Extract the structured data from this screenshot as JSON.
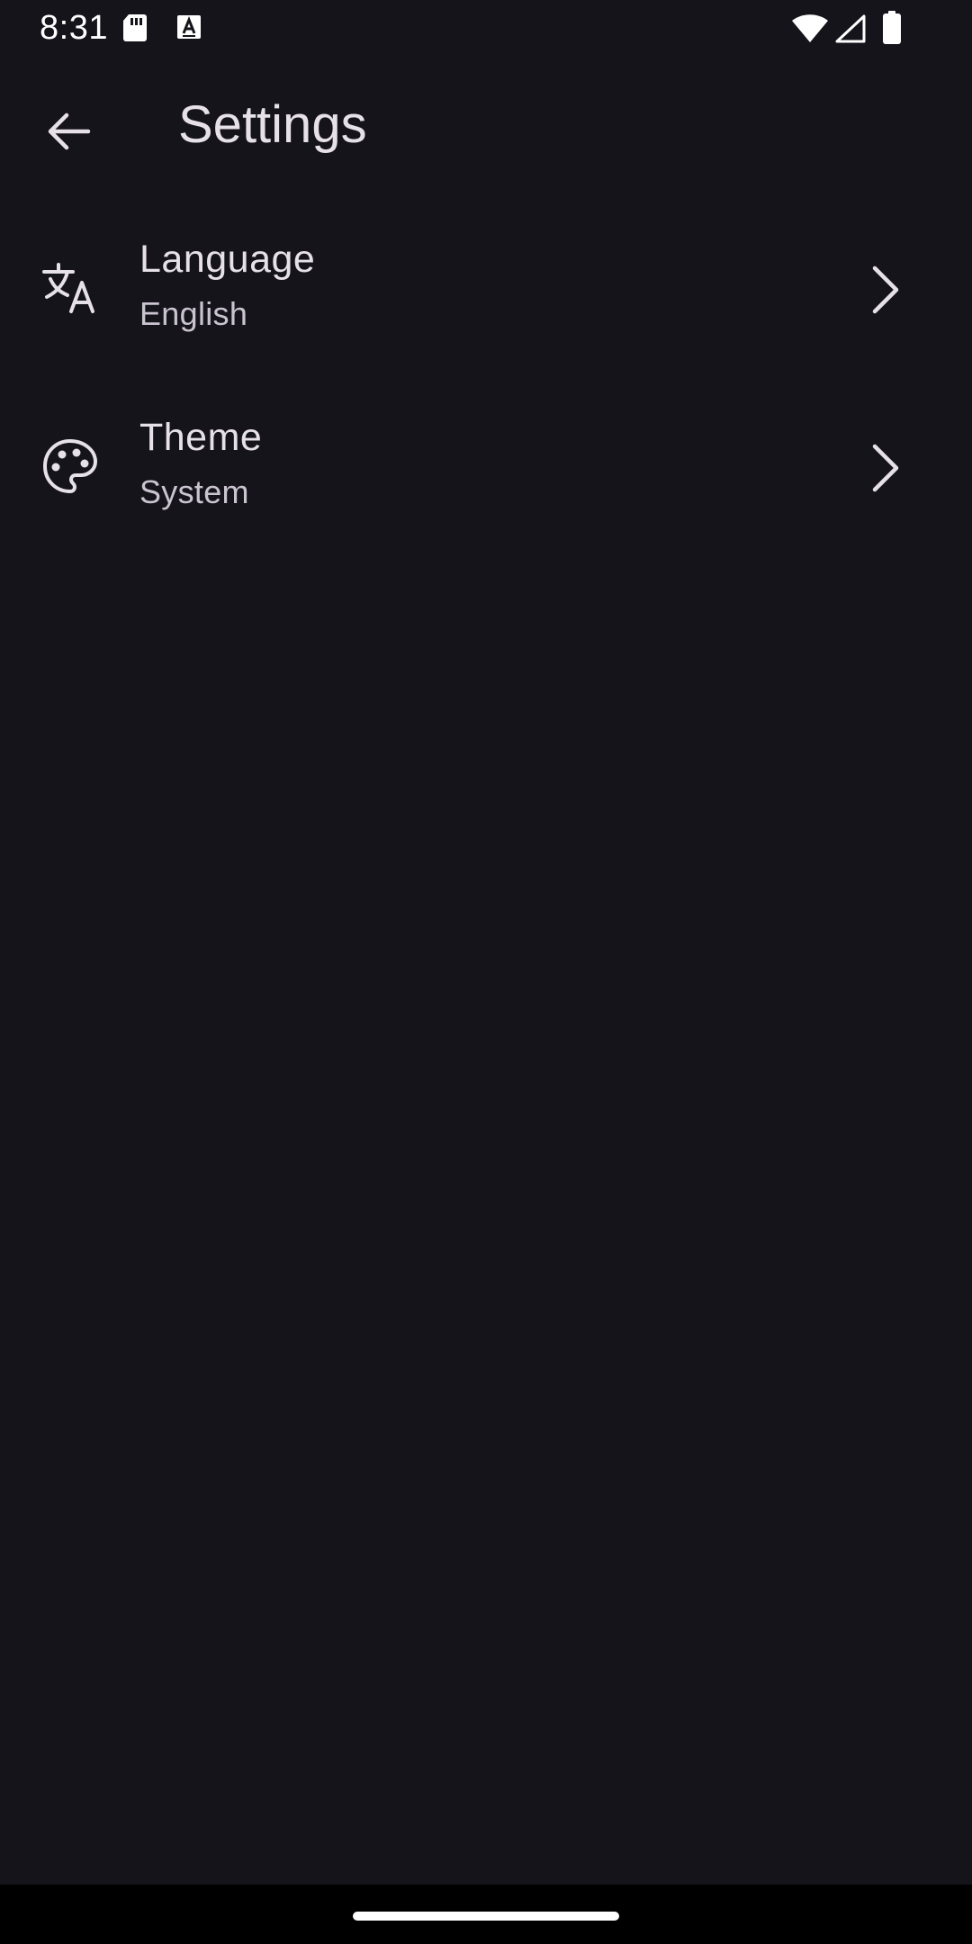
{
  "status_bar": {
    "time": "8:31",
    "icons": [
      "sd-card-icon",
      "keyboard-a-icon",
      "wifi-icon",
      "signal-icon",
      "battery-icon"
    ]
  },
  "app_bar": {
    "back_icon": "arrow-back-icon",
    "title": "Settings"
  },
  "settings": {
    "items": [
      {
        "icon": "translate-icon",
        "title": "Language",
        "subtitle": "English"
      },
      {
        "icon": "palette-icon",
        "title": "Theme",
        "subtitle": "System"
      }
    ]
  },
  "colors": {
    "background": "#16141b",
    "text_primary": "#e6e0e9",
    "text_secondary": "#cac4d0",
    "nav_bar": "#000000"
  }
}
